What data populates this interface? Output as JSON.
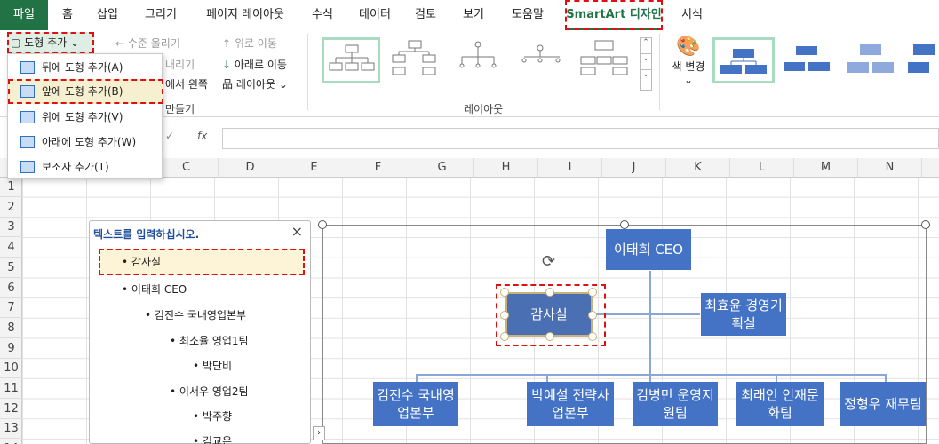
{
  "tabs": [
    "파일",
    "홈",
    "삽입",
    "그리기",
    "페이지 레이아웃",
    "수식",
    "데이터",
    "검토",
    "보기",
    "도움말",
    "SmartArt 디자인",
    "서식"
  ],
  "ribbon": {
    "add_shape": "도형 추가",
    "promote": "수준 올리기",
    "demote": "내리기",
    "right_to_left": "에서 왼쪽",
    "move_up": "위로 이동",
    "move_down": "아래로 이동",
    "layout_btn": "레이아웃",
    "create_graphic_group": "만들기",
    "layouts_group": "레이아웃",
    "change_colors": "색 변경"
  },
  "menu": {
    "items": [
      "뒤에 도형 추가(A)",
      "앞에 도형 추가(B)",
      "위에 도형 추가(V)",
      "아래에 도형 추가(W)",
      "보조자 추가(T)"
    ]
  },
  "formula": {
    "fx": "fx"
  },
  "columns": [
    "C",
    "D",
    "E",
    "F",
    "G",
    "H",
    "I",
    "J",
    "K",
    "L",
    "M",
    "N"
  ],
  "rows": [
    "1",
    "2",
    "3",
    "4",
    "5",
    "6",
    "7",
    "8",
    "9",
    "10",
    "11",
    "12",
    "13",
    "14"
  ],
  "text_pane": {
    "title": "텍스트를 입력하십시오.",
    "close": "×",
    "items": [
      "감사실",
      "이태희 CEO",
      "김진수 국내영업본부",
      "최소율 영업1팀",
      "박단비",
      "이서우 영업2팀",
      "박주향",
      "김교은"
    ]
  },
  "smartart": {
    "ceo": "이태희 CEO",
    "audit": "감사실",
    "assistant": "최효윤 경영기획실",
    "departments": [
      "김진수 국내영업본부",
      "박예설 전략사업본부",
      "김병민 운영지원팀",
      "최래인 인재문화팀",
      "정형우 재무팀"
    ]
  },
  "colors": {
    "accent": "#217346",
    "shape": "#4472c4",
    "highlight": "#d11111"
  }
}
